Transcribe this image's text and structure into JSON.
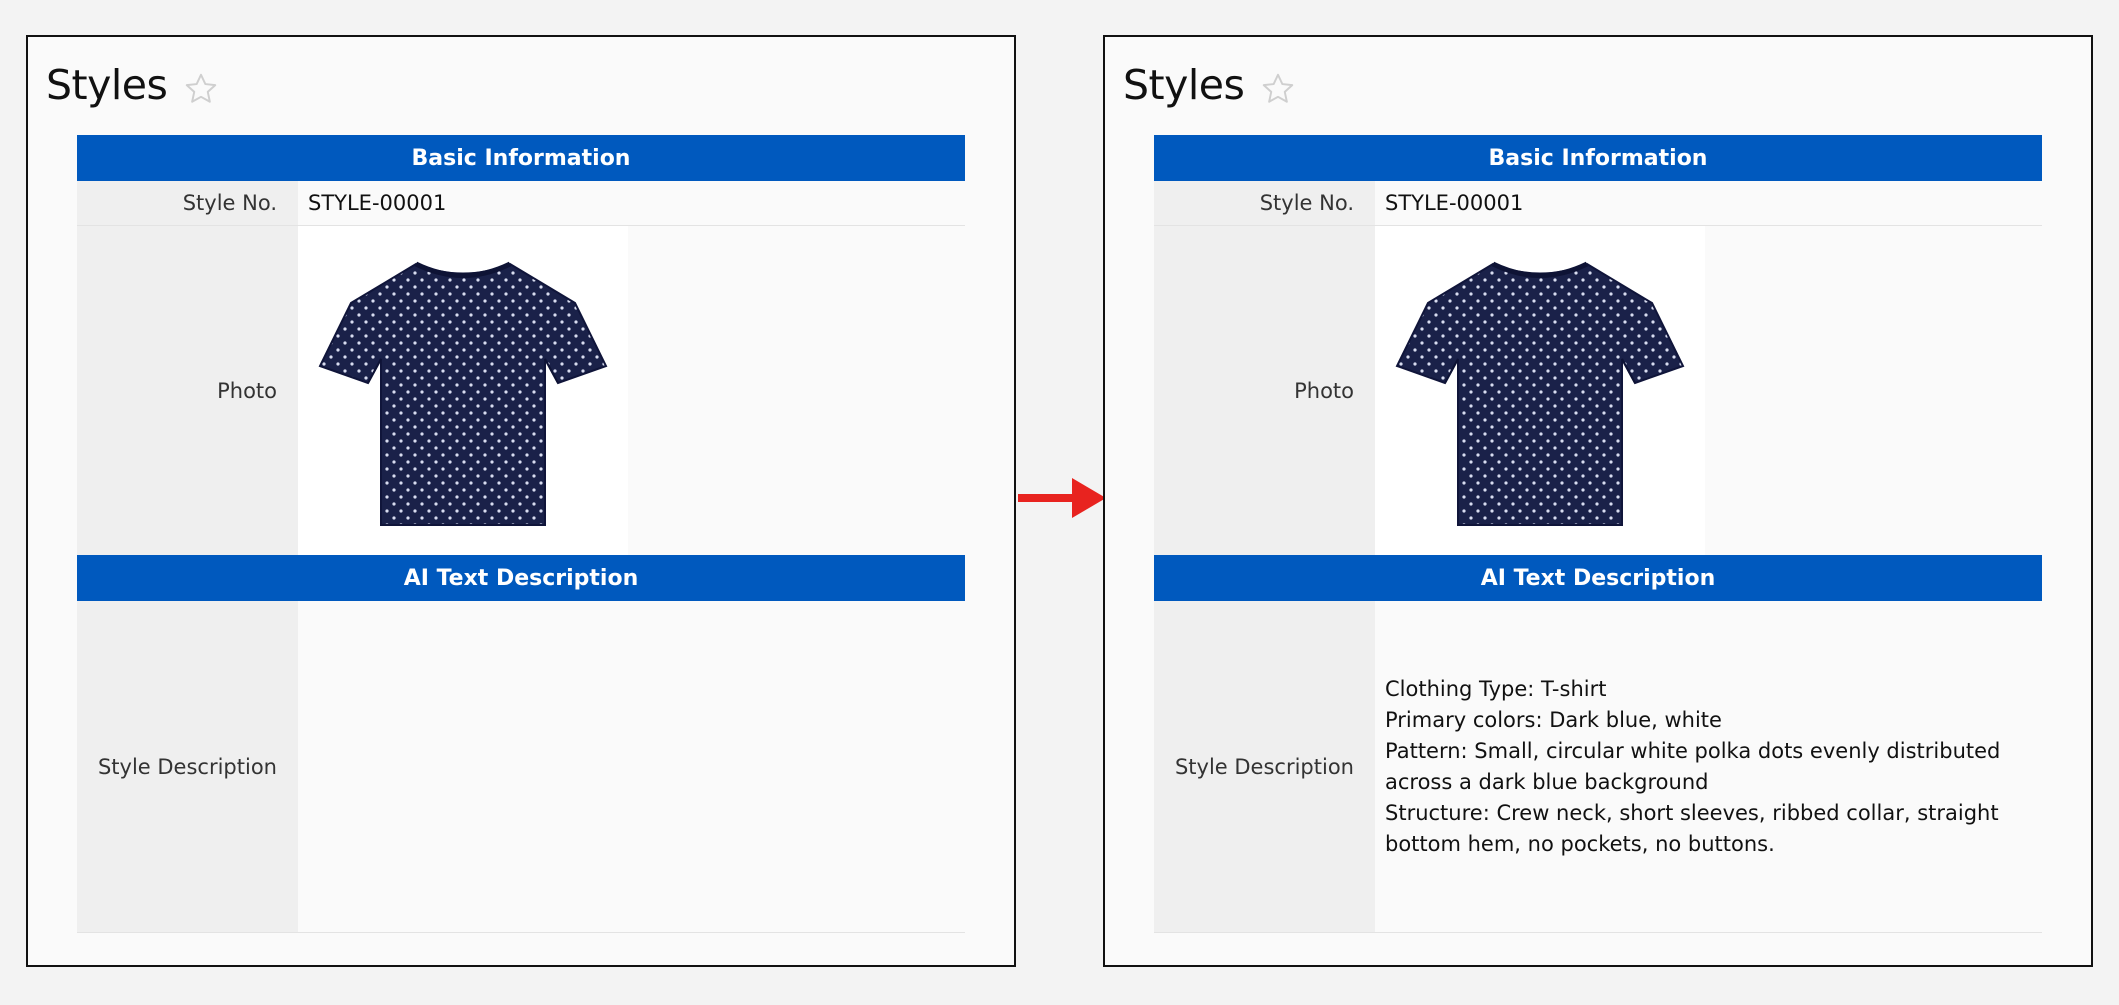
{
  "panels": [
    {
      "title": "Styles",
      "sections": {
        "basic_header": "Basic Information",
        "ai_header": "AI Text Description"
      },
      "fields": {
        "style_no_label": "Style No.",
        "style_no_value": "STYLE-00001",
        "photo_label": "Photo",
        "style_desc_label": "Style Description",
        "style_desc_value": ""
      }
    },
    {
      "title": "Styles",
      "sections": {
        "basic_header": "Basic Information",
        "ai_header": "AI Text Description"
      },
      "fields": {
        "style_no_label": "Style No.",
        "style_no_value": "STYLE-00001",
        "photo_label": "Photo",
        "style_desc_label": "Style Description",
        "style_desc_value": "Clothing Type: T-shirt\nPrimary colors: Dark blue, white\nPattern: Small, circular white polka dots evenly distributed\nacross a dark blue background\nStructure: Crew neck, short sleeves, ribbed collar, straight\nbottom hem, no pockets, no buttons."
      }
    }
  ],
  "colors": {
    "section_header_bg": "#0059be",
    "arrow": "#e8231f",
    "shirt": "#1a2149"
  },
  "icons": {
    "favorite": "star-outline-icon",
    "transition": "right-arrow-icon"
  }
}
